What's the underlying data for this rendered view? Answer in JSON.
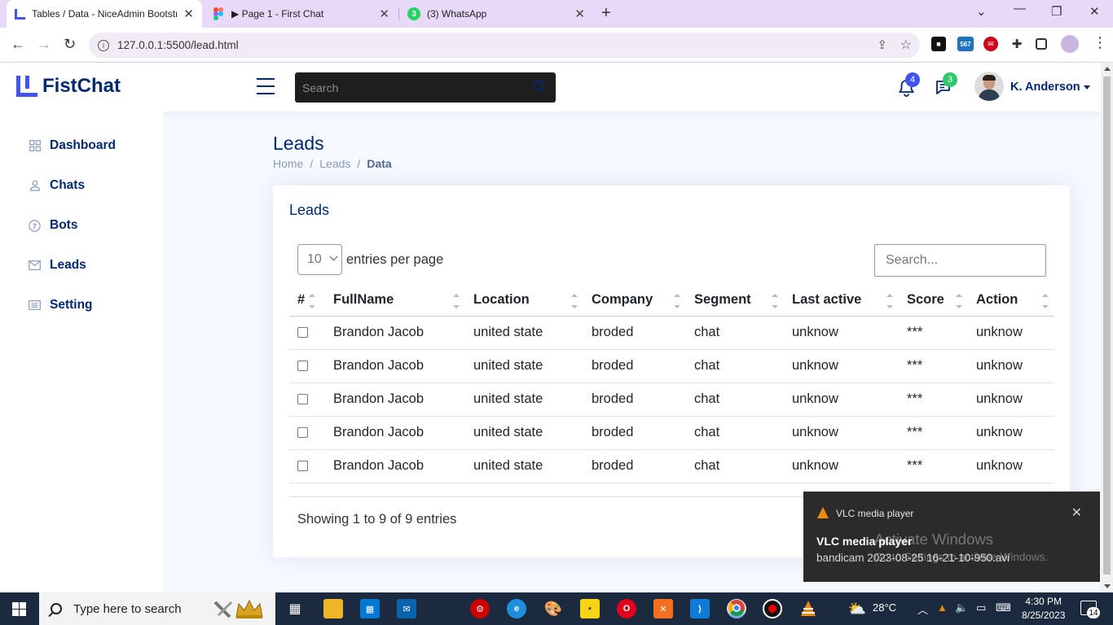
{
  "browser": {
    "tabs": [
      {
        "title": "Tables / Data - NiceAdmin Bootstrap",
        "close": "✕"
      },
      {
        "title": "▶ Page 1 - First Chat",
        "close": "✕"
      },
      {
        "title": "(3) WhatsApp",
        "close": "✕"
      }
    ],
    "whatsapp_badge": "3",
    "url": "127.0.0.1:5500/lead.html",
    "ext_badge": "567"
  },
  "header": {
    "brand": "FistChat",
    "search_placeholder": "Search",
    "notifications_count": "4",
    "messages_count": "3",
    "user_name": "K. Anderson"
  },
  "sidebar": {
    "items": [
      {
        "label": "Dashboard",
        "icon": "grid-icon"
      },
      {
        "label": "Chats",
        "icon": "person-icon"
      },
      {
        "label": "Bots",
        "icon": "question-circle-icon"
      },
      {
        "label": "Leads",
        "icon": "envelope-icon"
      },
      {
        "label": "Setting",
        "icon": "card-list-icon"
      }
    ]
  },
  "page": {
    "title": "Leads",
    "breadcrumb": [
      "Home",
      "Leads",
      "Data"
    ]
  },
  "card": {
    "title": "Leads",
    "per_page_value": "10",
    "per_page_label": "entries per page",
    "search_placeholder": "Search...",
    "columns": [
      "#",
      "FullName",
      "Location",
      "Company",
      "Segment",
      "Last active",
      "Score",
      "Action"
    ],
    "rows": [
      {
        "name": "Brandon Jacob",
        "location": "united state",
        "company": "broded",
        "segment": "chat",
        "last_active": "unknow",
        "score": "***",
        "action": "unknow"
      },
      {
        "name": "Brandon Jacob",
        "location": "united state",
        "company": "broded",
        "segment": "chat",
        "last_active": "unknow",
        "score": "***",
        "action": "unknow"
      },
      {
        "name": "Brandon Jacob",
        "location": "united state",
        "company": "broded",
        "segment": "chat",
        "last_active": "unknow",
        "score": "***",
        "action": "unknow"
      },
      {
        "name": "Brandon Jacob",
        "location": "united state",
        "company": "broded",
        "segment": "chat",
        "last_active": "unknow",
        "score": "***",
        "action": "unknow"
      },
      {
        "name": "Brandon Jacob",
        "location": "united state",
        "company": "broded",
        "segment": "chat",
        "last_active": "unknow",
        "score": "***",
        "action": "unknow"
      }
    ],
    "footer": "Showing 1 to 9 of 9 entries"
  },
  "toast": {
    "app": "VLC media player",
    "heading": "VLC media player",
    "body": "bandicam 2023-08-25 16-21-10-950.avi",
    "close": "✕"
  },
  "watermark": {
    "line1": "Activate Windows",
    "line2": "Go to Settings to activate Windows."
  },
  "taskbar": {
    "search_placeholder": "Type here to search",
    "weather": "28°C",
    "time": "4:30 PM",
    "date": "8/25/2023",
    "notification_count": "14"
  },
  "colors": {
    "primary": "#4154f1",
    "navy": "#012970",
    "muted": "#899bbd",
    "tab_strip": "#e9d9f8"
  }
}
